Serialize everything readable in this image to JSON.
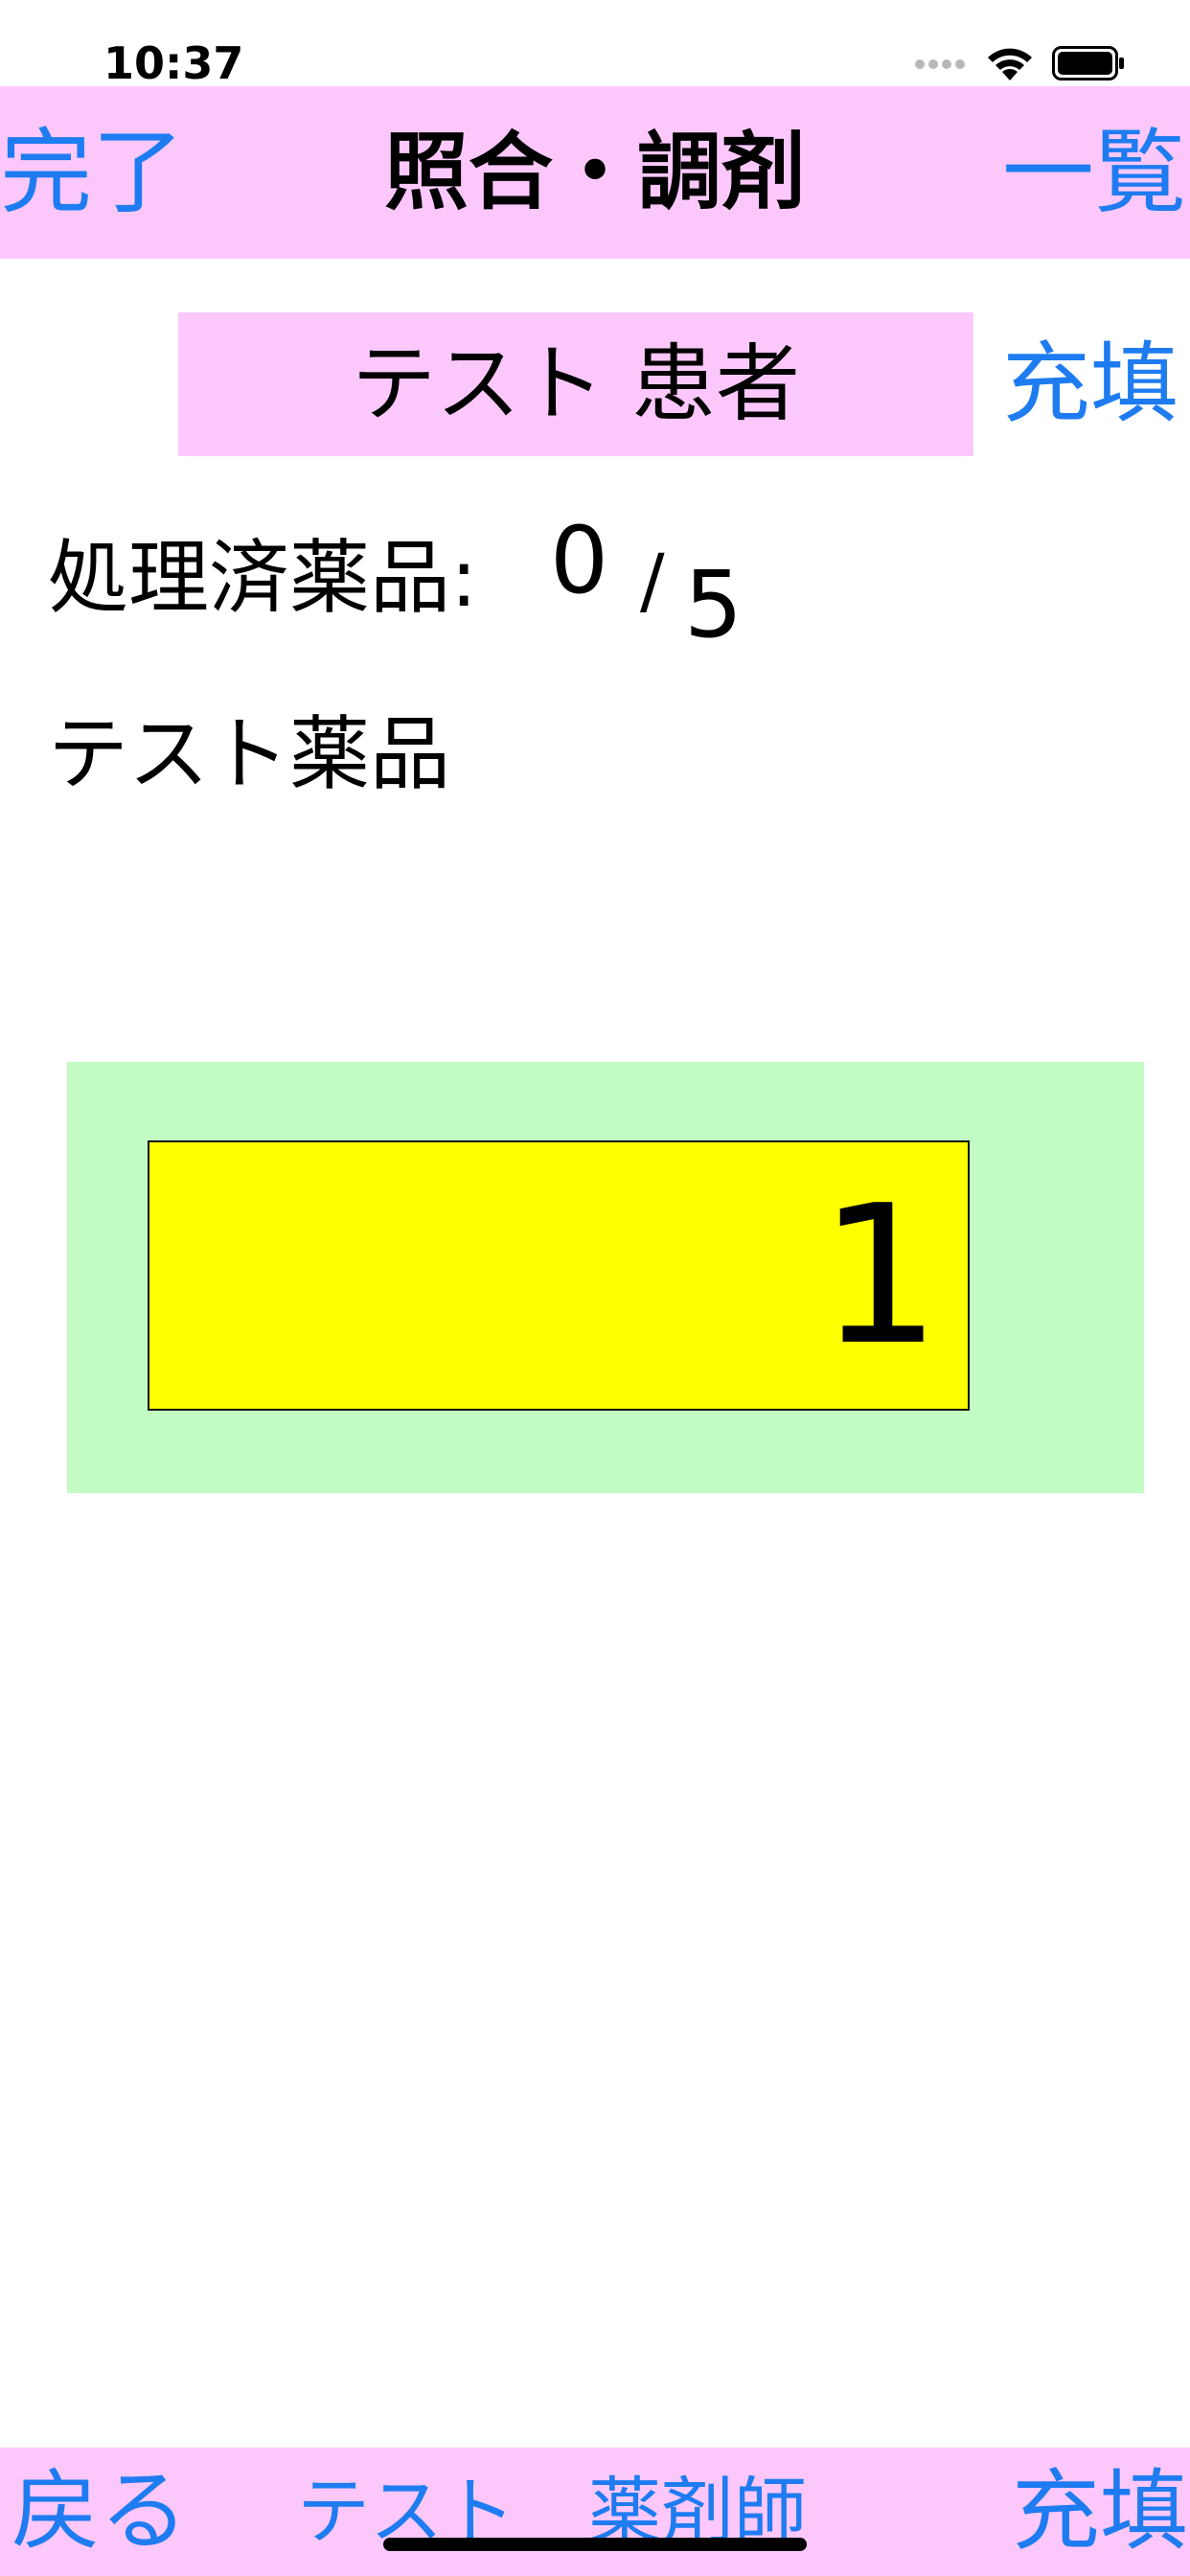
{
  "status_bar": {
    "time": "10:37",
    "icons": [
      "signal-icon",
      "wifi-icon",
      "battery-icon"
    ]
  },
  "nav": {
    "left_button": "完了",
    "title": "照合・調剤",
    "right_button": "一覧"
  },
  "patient": {
    "name": "テスト 患者",
    "fill_link": "充填"
  },
  "progress": {
    "label": "処理済薬品:",
    "processed": "0",
    "separator": "/",
    "total": "5"
  },
  "drug": {
    "name": "テスト薬品"
  },
  "quantity": {
    "value": "1"
  },
  "bottom_bar": {
    "back_button": "戻る",
    "user": "テスト　薬剤師",
    "fill_button": "充填"
  },
  "colors": {
    "accent": "#1e7cf0",
    "bar_background": "#fcc8fc",
    "panel_background": "#c2fcc2",
    "field_background": "#ffff00"
  }
}
